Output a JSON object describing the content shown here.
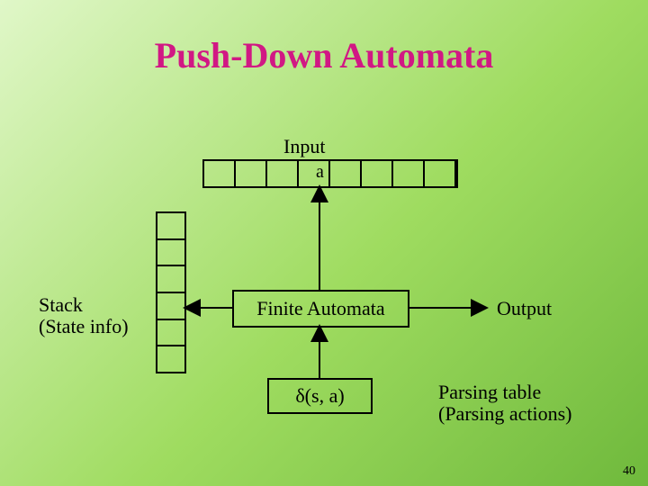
{
  "title": "Push-Down Automata",
  "slide_number": "40",
  "input": {
    "label": "Input",
    "symbol": "a"
  },
  "stack": {
    "label_line1": "Stack",
    "label_line2": "(State info)"
  },
  "fa_box": "Finite Automata",
  "output": {
    "label": "Output"
  },
  "delta": "δ(s, a)",
  "parsing_table": {
    "line1": "Parsing table",
    "line2": "(Parsing actions)"
  }
}
